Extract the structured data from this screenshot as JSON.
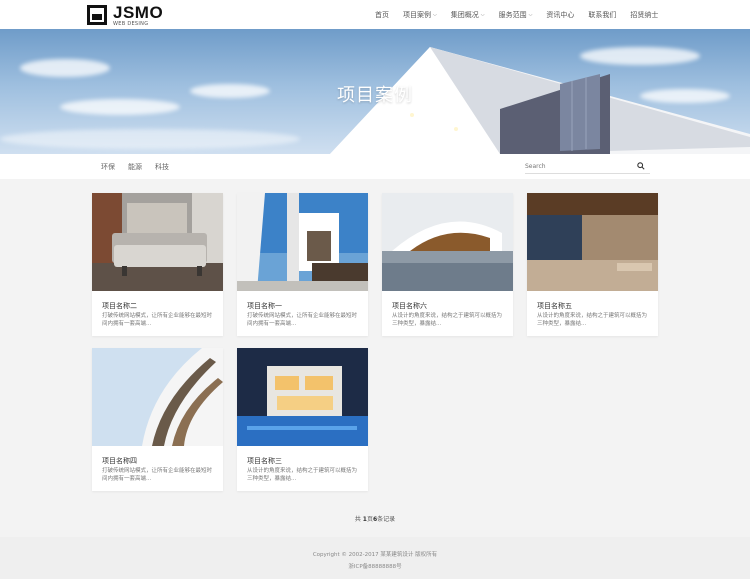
{
  "brand": {
    "name": "JSMO",
    "tagline": "WEB DESING"
  },
  "nav": [
    {
      "label": "首页",
      "dropdown": false
    },
    {
      "label": "项目案例",
      "dropdown": true
    },
    {
      "label": "集团概况",
      "dropdown": true
    },
    {
      "label": "服务范围",
      "dropdown": true
    },
    {
      "label": "资讯中心",
      "dropdown": false
    },
    {
      "label": "联系我们",
      "dropdown": false
    },
    {
      "label": "招贤纳士",
      "dropdown": false
    }
  ],
  "banner": {
    "title": "项目案例"
  },
  "filters": [
    "环保",
    "能源",
    "科技"
  ],
  "search": {
    "placeholder": "Search"
  },
  "cards": [
    {
      "title": "项目名称二",
      "desc": "打破传统网站模式，让所有企业能够在最短时间内拥有一套高端...",
      "image": "sofa-interior"
    },
    {
      "title": "项目名称一",
      "desc": "打破传统网站模式，让所有企业能够在最短时间内拥有一套高端...",
      "image": "white-facade"
    },
    {
      "title": "项目名称六",
      "desc": "从设计的角度来说，结构之于建筑可以概括为三种类型，暴露结...",
      "image": "curved-pavilion"
    },
    {
      "title": "项目名称五",
      "desc": "从设计的角度来说，结构之于建筑可以概括为三种类型，暴露结...",
      "image": "terrace-night"
    },
    {
      "title": "项目名称四",
      "desc": "打破传统网站模式，让所有企业能够在最短时间内拥有一套高端...",
      "image": "curved-balconies"
    },
    {
      "title": "项目名称三",
      "desc": "从设计的角度来说，结构之于建筑可以概括为三种类型，暴露结...",
      "image": "villa-pool"
    }
  ],
  "pagination": {
    "prefix": "共 ",
    "pages": "1",
    "mid1": "页",
    "records": "6",
    "suffix": "条记录"
  },
  "footer": {
    "copyright": "Copyright © 2002-2017 某某建筑设计 版权所有",
    "icp": "浙ICP备88888888号"
  }
}
